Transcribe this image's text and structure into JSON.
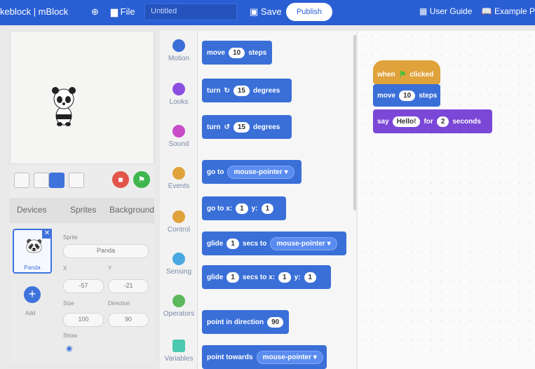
{
  "header": {
    "app_title": "keblock | mBlock",
    "file_label": "File",
    "project_title": "Untitled",
    "save_label": "Save",
    "publish_label": "Publish",
    "user_guide_label": "User Guide",
    "examples_label": "Example Pr"
  },
  "stage_tabs": {
    "devices": "Devices",
    "sprites": "Sprites",
    "background": "Background"
  },
  "sprite_panel": {
    "sprite_name_label": "Sprite",
    "sprite_name": "Panda",
    "thumb_label": "Panda",
    "x_label": "X",
    "x_value": "-57",
    "y_label": "Y",
    "y_value": "-21",
    "size_label": "Size",
    "size_value": "100",
    "direction_label": "Direction",
    "direction_value": "90",
    "show_label": "Show",
    "add_label": "Add"
  },
  "categories": [
    {
      "label": "Motion",
      "color": "#3a6fd8"
    },
    {
      "label": "Looks",
      "color": "#8a4ee0"
    },
    {
      "label": "Sound",
      "color": "#c84cc8"
    },
    {
      "label": "Events",
      "color": "#e0a23a"
    },
    {
      "label": "Control",
      "color": "#e0a23a"
    },
    {
      "label": "Sensing",
      "color": "#4aa8e0"
    },
    {
      "label": "Operators",
      "color": "#5cb85c"
    },
    {
      "label": "Variables",
      "color": "#4ac8b0"
    }
  ],
  "palette": {
    "move": {
      "a": "move",
      "v": "10",
      "b": "steps"
    },
    "turn_cw": {
      "a": "turn",
      "icon": "↻",
      "v": "15",
      "b": "degrees"
    },
    "turn_ccw": {
      "a": "turn",
      "icon": "↺",
      "v": "15",
      "b": "degrees"
    },
    "goto": {
      "a": "go to",
      "menu": "mouse-pointer ▾"
    },
    "goto_xy": {
      "a": "go to x:",
      "x": "1",
      "ylab": "y:",
      "y": "1"
    },
    "glide": {
      "a": "glide",
      "v": "1",
      "b": "secs to",
      "menu": "mouse-pointer ▾"
    },
    "glide_xy": {
      "a": "glide",
      "v": "1",
      "b": "secs to x:",
      "x": "1",
      "ylab": "y:",
      "y": "1"
    },
    "point_dir": {
      "a": "point in direction",
      "v": "90"
    },
    "point_towards": {
      "a": "point towards",
      "menu": "mouse-pointer ▾"
    }
  },
  "script": {
    "hat": {
      "a": "when",
      "b": "clicked"
    },
    "move": {
      "a": "move",
      "v": "10",
      "b": "steps"
    },
    "say": {
      "a": "say",
      "msg": "Hello!",
      "b": "for",
      "v": "2",
      "c": "seconds"
    }
  }
}
